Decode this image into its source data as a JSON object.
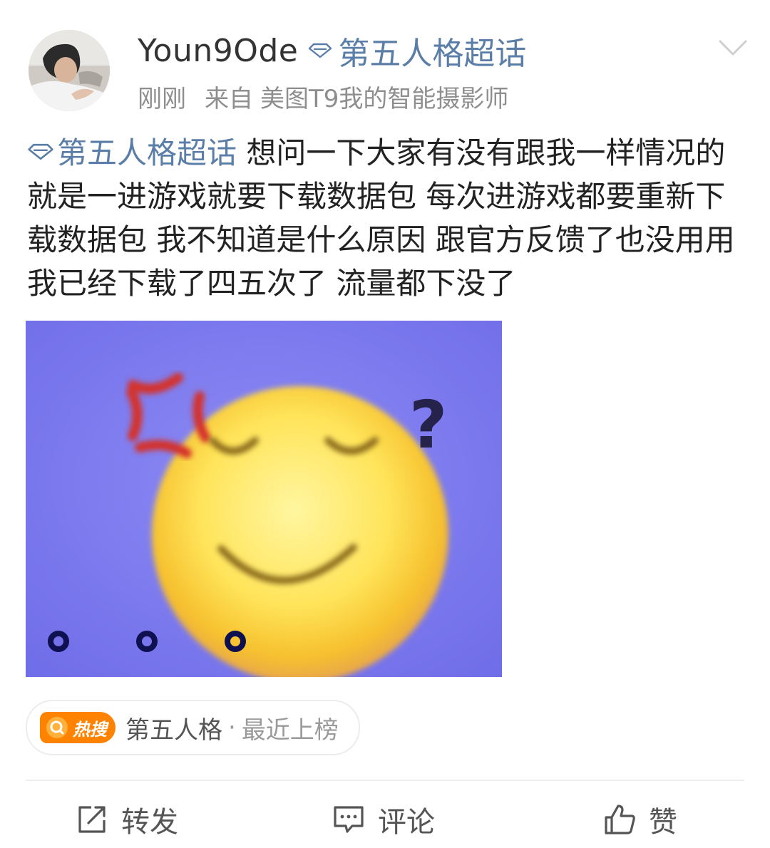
{
  "user": {
    "name": "Youn9Ode",
    "avatar_icon": "avatar-photo"
  },
  "topic": {
    "name": "第五人格超话",
    "icon": "super-topic-diamond-icon",
    "color": "#5b7ea8"
  },
  "meta": {
    "time": "刚刚",
    "source_prefix": "来自",
    "source_device": "美图T9我的智能摄影师"
  },
  "post": {
    "tag": "第五人格超话",
    "text": " 想问一下大家有没有跟我一样情况的 就是一进游戏就要下载数据包 每次进游戏都要重新下载数据包 我不知道是什么原因 跟官方反馈了也没用用 我已经下载了四五次了 流量都下没了"
  },
  "image": {
    "description_icon": "angry-smiley-sticker",
    "background_color": "#7b78f0"
  },
  "hot_search": {
    "label": "热搜",
    "topic": "第五人格",
    "separator": "·",
    "status": "最近上榜",
    "accent_color": "#ff8200"
  },
  "actions": {
    "repost": "转发",
    "comment": "评论",
    "like": "赞"
  }
}
